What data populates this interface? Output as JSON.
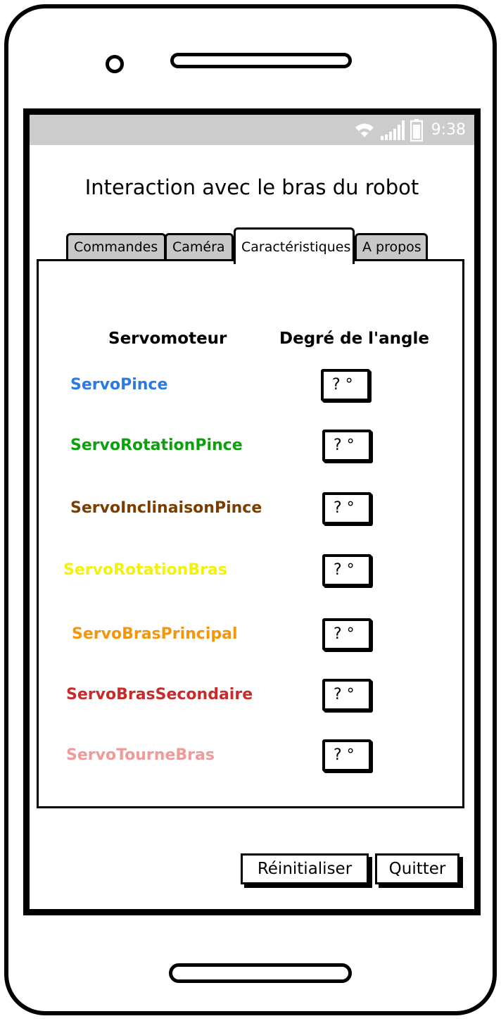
{
  "status_bar": {
    "time": "9:38",
    "icons": [
      "wifi-icon",
      "signal-icon",
      "battery-icon"
    ]
  },
  "app": {
    "title": "Interaction avec le bras du robot"
  },
  "tabs": [
    {
      "label": "Commandes",
      "active": false
    },
    {
      "label": "Caméra",
      "active": false
    },
    {
      "label": "Caractéristiques",
      "active": true
    },
    {
      "label": "A propos",
      "active": false
    }
  ],
  "table": {
    "col_servo": "Servomoteur",
    "col_angle": "Degré de l'angle",
    "rows": [
      {
        "name": "ServoPince",
        "color": "#2a7ae2",
        "angle": "? °"
      },
      {
        "name": "ServoRotationPince",
        "color": "#0aa10a",
        "angle": "? °"
      },
      {
        "name": "ServoInclinaisonPince",
        "color": "#7a3e00",
        "angle": "? °"
      },
      {
        "name": "ServoRotationBras",
        "color": "#f2f20a",
        "angle": "? °"
      },
      {
        "name": "ServoBrasPrincipal",
        "color": "#f5950a",
        "angle": "? °"
      },
      {
        "name": "ServoBrasSecondaire",
        "color": "#c92a2a",
        "angle": "? °"
      },
      {
        "name": "ServoTourneBras",
        "color": "#f09a9a",
        "angle": "? °"
      }
    ]
  },
  "buttons": {
    "reset": "Réinitialiser",
    "quit": "Quitter"
  }
}
